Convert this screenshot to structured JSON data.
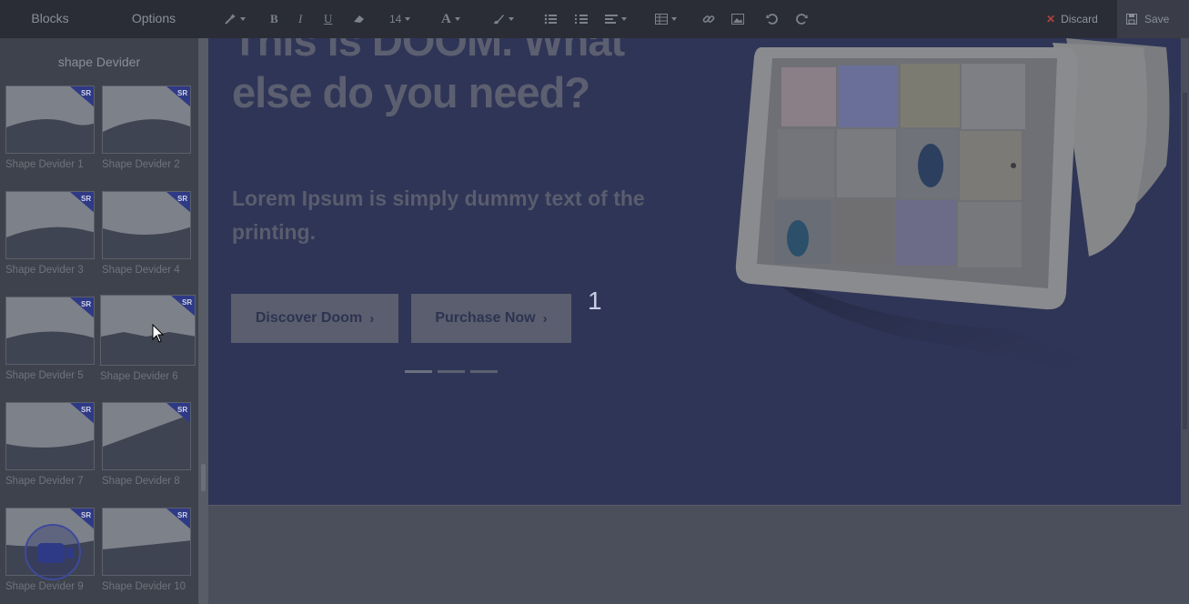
{
  "toolbar": {
    "tabs": [
      "Blocks",
      "Options"
    ],
    "font_size": "14",
    "discard_label": "Discard",
    "save_label": "Save"
  },
  "sidebar": {
    "heading": "shape Devider",
    "badge": "SR",
    "items": [
      {
        "label": "Shape Devider 1"
      },
      {
        "label": "Shape Devider 2"
      },
      {
        "label": "Shape Devider 3"
      },
      {
        "label": "Shape Devider 4"
      },
      {
        "label": "Shape Devider 5"
      },
      {
        "label": "Shape Devider 6"
      },
      {
        "label": "Shape Devider 7"
      },
      {
        "label": "Shape Devider 8"
      },
      {
        "label": "Shape Devider 9"
      },
      {
        "label": "Shape Devider 10"
      }
    ]
  },
  "hero": {
    "title": "This is DOOM. What else do you need?",
    "subtitle": "Lorem Ipsum is simply dummy text of the printing.",
    "primary_button": "Discover Doom",
    "secondary_button": "Purchase Now",
    "slide_number": "1",
    "slides_total": 3,
    "active_slide": 1
  },
  "colors": {
    "toolbar_bg": "#2a2d36",
    "sidebar_bg": "#3e424c",
    "canvas_bg": "#2f3556",
    "discard_accent": "#b0443e"
  }
}
